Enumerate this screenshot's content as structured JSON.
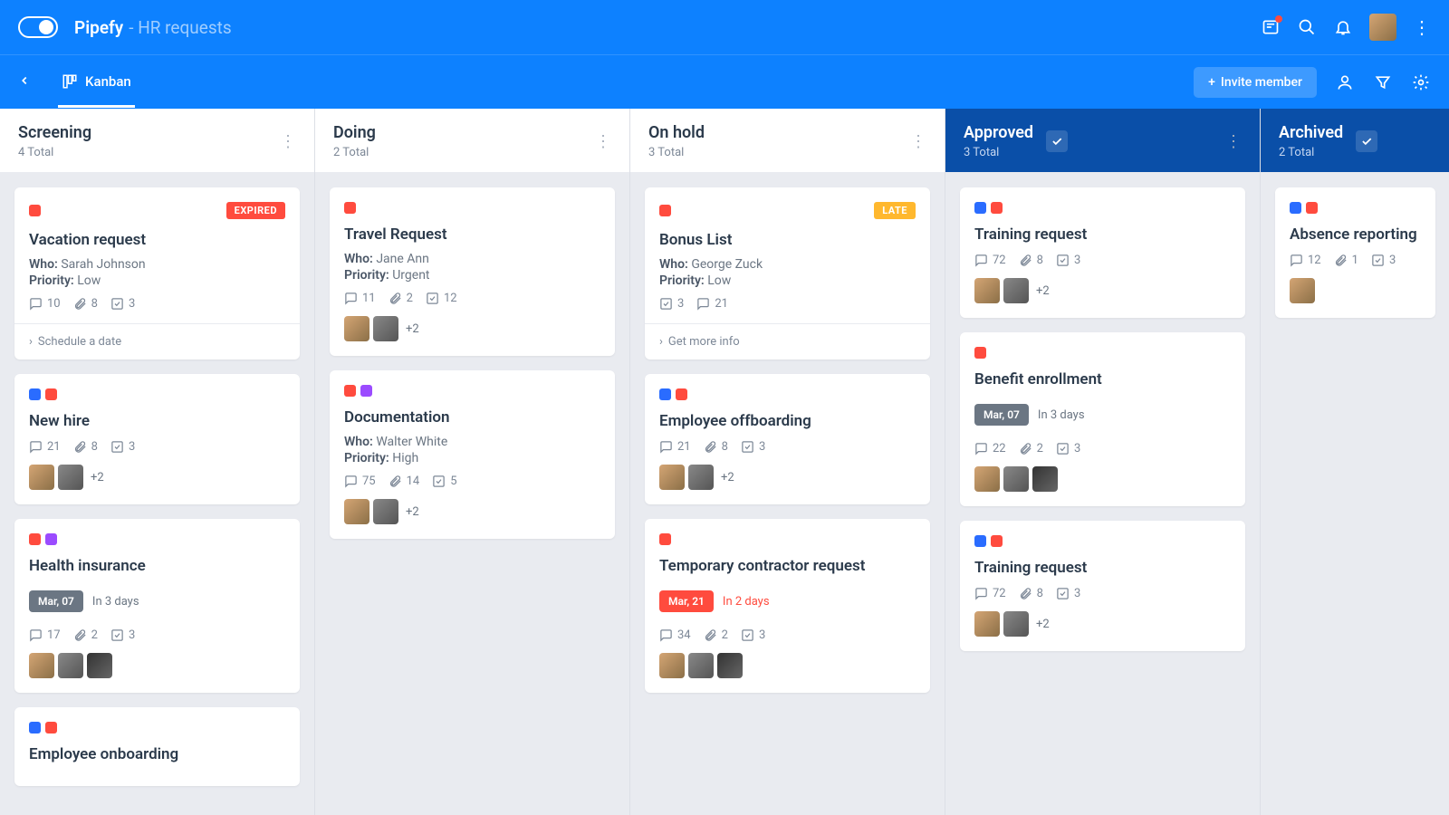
{
  "header": {
    "brand": "Pipefy",
    "context": "- HR requests",
    "invite_label": "Invite member",
    "view_label": "Kanban"
  },
  "columns": [
    {
      "title": "Screening",
      "count": "4 Total",
      "done": false,
      "cards": [
        {
          "labels": [
            "red"
          ],
          "status": "EXPIRED",
          "status_kind": "expired",
          "title": "Vacation request",
          "who": "Sarah Johnson",
          "priority": "Low",
          "comments": 10,
          "attach": 8,
          "checks": 3,
          "footer": "Schedule a date"
        },
        {
          "labels": [
            "blue",
            "red"
          ],
          "title": "New hire",
          "comments": 21,
          "attach": 8,
          "checks": 3,
          "avatars": [
            "a1",
            "a2"
          ],
          "more_av": "+2"
        },
        {
          "labels": [
            "red",
            "purple"
          ],
          "title": "Health insurance",
          "chip": "Mar, 07",
          "chip_kind": "",
          "due": "In 3 days",
          "comments": 17,
          "attach": 2,
          "checks": 3,
          "avatars": [
            "a1",
            "a2",
            "a3"
          ]
        },
        {
          "labels": [
            "blue",
            "red"
          ],
          "title": "Employee onboarding"
        }
      ]
    },
    {
      "title": "Doing",
      "count": "2 Total",
      "done": false,
      "cards": [
        {
          "labels": [
            "red"
          ],
          "title": "Travel Request",
          "who": "Jane Ann",
          "priority": "Urgent",
          "comments": 11,
          "attach": 2,
          "checks": 12,
          "avatars": [
            "a1",
            "a2"
          ],
          "more_av": "+2"
        },
        {
          "labels": [
            "red",
            "purple"
          ],
          "title": "Documentation",
          "who": "Walter White",
          "priority": "High",
          "comments": 75,
          "attach": 14,
          "checks": 5,
          "avatars": [
            "a1",
            "a2"
          ],
          "more_av": "+2"
        }
      ]
    },
    {
      "title": "On hold",
      "count": "3 Total",
      "done": false,
      "cards": [
        {
          "labels": [
            "red"
          ],
          "status": "LATE",
          "status_kind": "late",
          "title": "Bonus List",
          "who": "George Zuck",
          "priority": "Low",
          "checks": 3,
          "comments": 21,
          "footer": "Get more info"
        },
        {
          "labels": [
            "blue",
            "red"
          ],
          "title": "Employee offboarding",
          "comments": 21,
          "attach": 8,
          "checks": 3,
          "avatars": [
            "a1",
            "a2"
          ],
          "more_av": "+2"
        },
        {
          "labels": [
            "red"
          ],
          "title": "Temporary contractor request",
          "chip": "Mar, 21",
          "chip_kind": "red",
          "due": "In 2 days",
          "due_kind": "red",
          "comments": 34,
          "attach": 2,
          "checks": 3,
          "avatars": [
            "a1",
            "a2",
            "a3"
          ]
        }
      ]
    },
    {
      "title": "Approved",
      "count": "3 Total",
      "done": true,
      "cards": [
        {
          "labels": [
            "blue",
            "red"
          ],
          "title": "Training request",
          "comments": 72,
          "attach": 8,
          "checks": 3,
          "avatars": [
            "a1",
            "a2"
          ],
          "more_av": "+2"
        },
        {
          "labels": [
            "red"
          ],
          "title": "Benefit enrollment",
          "chip": "Mar, 07",
          "chip_kind": "",
          "due": "In 3 days",
          "comments": 22,
          "attach": 2,
          "checks": 3,
          "avatars": [
            "a1",
            "a2",
            "a3"
          ]
        },
        {
          "labels": [
            "blue",
            "red"
          ],
          "title": "Training request",
          "comments": 72,
          "attach": 8,
          "checks": 3,
          "avatars": [
            "a1",
            "a2"
          ],
          "more_av": "+2"
        }
      ]
    },
    {
      "title": "Archived",
      "count": "2 Total",
      "done": true,
      "narrow": true,
      "cards": [
        {
          "labels": [
            "blue",
            "red"
          ],
          "title": "Absence reporting",
          "comments": 12,
          "attach": 1,
          "checks": 3,
          "avatars": [
            "a1"
          ]
        }
      ]
    }
  ],
  "labels": {
    "who": "Who:",
    "priority": "Priority:"
  }
}
